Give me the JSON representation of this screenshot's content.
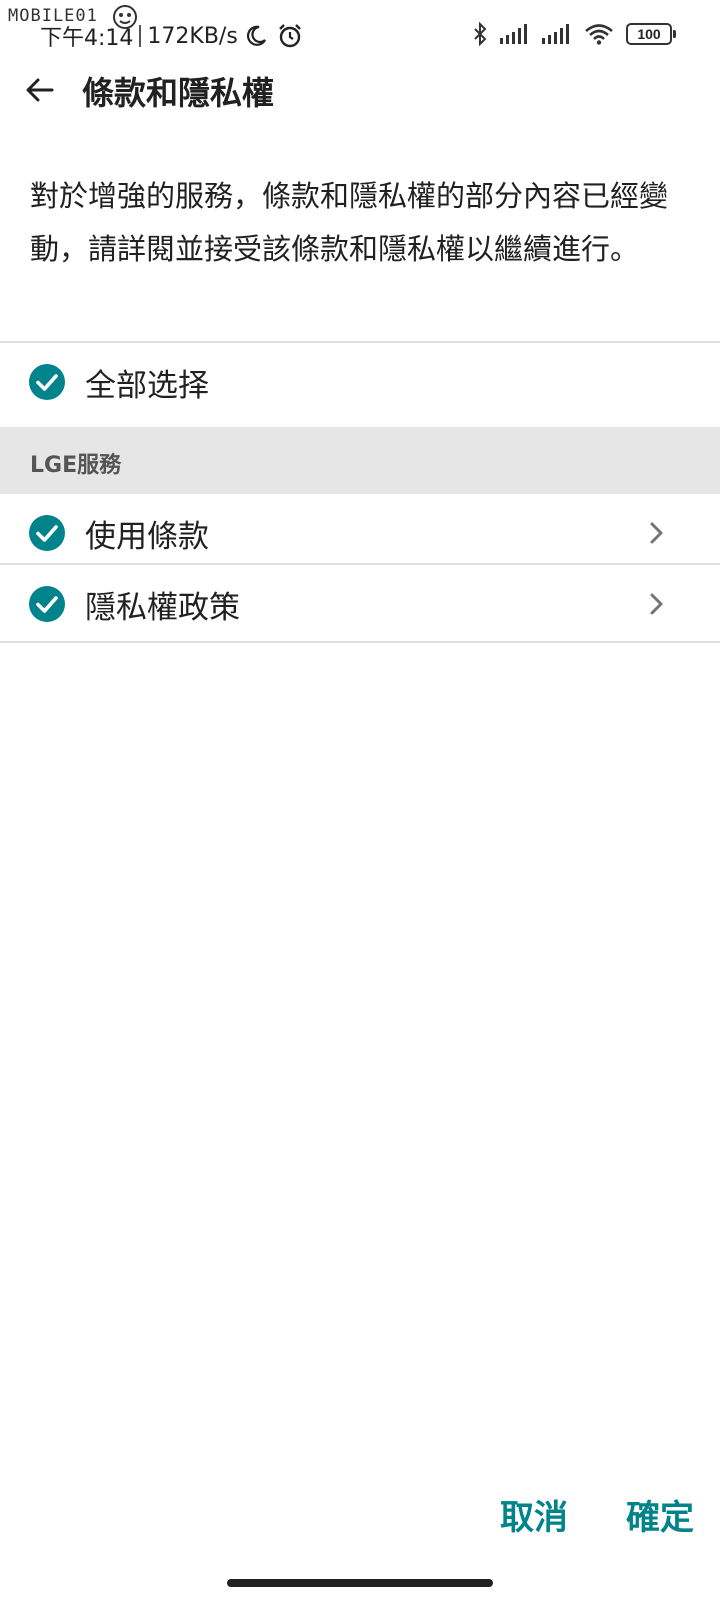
{
  "watermark": "MOBILE01",
  "status_bar": {
    "time": "下午4:14",
    "speed": "172KB/s",
    "battery": "100",
    "icons": [
      "moon-icon",
      "alarm-icon",
      "bluetooth-icon",
      "signal-icon",
      "signal-icon",
      "wifi-icon",
      "battery-icon"
    ]
  },
  "header": {
    "back_icon": "back-arrow-icon",
    "title": "條款和隱私權"
  },
  "intro_text": "對於增強的服務，條款和隱私權的部分內容已經變動，請詳閱並接受該條款和隱私權以繼續進行。",
  "select_all": {
    "label": "全部选择",
    "checked": true
  },
  "section": {
    "label": "LGE服務"
  },
  "items": [
    {
      "label": "使用條款",
      "checked": true
    },
    {
      "label": "隱私權政策",
      "checked": true
    }
  ],
  "footer": {
    "cancel_label": "取消",
    "confirm_label": "確定"
  },
  "colors": {
    "accent": "#00838a",
    "check": "#00838a",
    "section_bg": "#e6e6e6",
    "divider": "#e0e0e0"
  }
}
